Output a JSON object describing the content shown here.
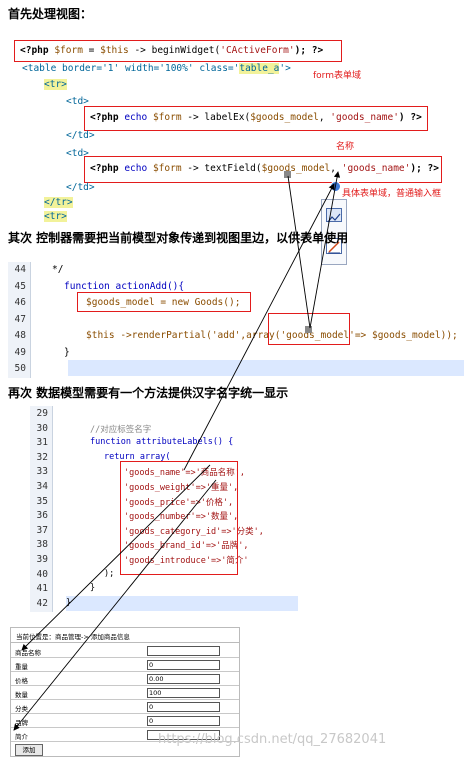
{
  "section1": {
    "heading": "首先处理视图：",
    "line1": {
      "a": "<?php ",
      "b": "$form",
      "c": " = ",
      "d": "$this",
      "e": " -> beginWidget(",
      "f": "'CActiveForm'",
      "g": "); ?>"
    },
    "line2": {
      "a": "<table ",
      "b": "border='1' width='100%' class='",
      "c": "table_a",
      "d": "'>"
    },
    "tr_open": "<tr>",
    "td_open1": "<td>",
    "line_label": {
      "a": "<?php ",
      "b": "echo ",
      "c": "$form",
      "d": " -> labelEx(",
      "e": "$goods_model",
      "f": ", ",
      "g": "'goods_name'",
      "h": ") ?>"
    },
    "td_close1": "</td>",
    "td_open2": "<td>",
    "line_text": {
      "a": "<?php ",
      "b": "echo ",
      "c": "$form",
      "d": " -> textField(",
      "e": "$goods_model",
      "f": ", ",
      "g": "'goods_name'",
      "h": "); ?>"
    },
    "td_close2": "</td>",
    "tr_close": "</tr>",
    "tr_open2": "<tr>",
    "annot_form": "form表单域",
    "annot_name": "名称",
    "annot_input": "具体表单域，普通输入框"
  },
  "section2": {
    "heading": "其次 控制器需要把当前模型对象传递到视图里边，以供表单使用",
    "lines": [
      {
        "no": "44",
        "text": "*/"
      },
      {
        "no": "45",
        "text": "function actionAdd(){"
      },
      {
        "no": "46",
        "text": "$goods_model = new Goods();"
      },
      {
        "no": "47",
        "text": ""
      },
      {
        "no": "48",
        "text": "$this ->renderPartial('add',array('goods_model'=> $goods_model));"
      },
      {
        "no": "49",
        "text": "}"
      },
      {
        "no": "50",
        "text": ""
      }
    ]
  },
  "section3": {
    "heading": "再次 数据模型需要有一个方法提供汉字名字统一显示",
    "lines": [
      {
        "no": "29",
        "text": ""
      },
      {
        "no": "30",
        "text": "//对应标签名字"
      },
      {
        "no": "31",
        "text": "function attributeLabels() {"
      },
      {
        "no": "32",
        "text": "return array("
      },
      {
        "no": "33",
        "text": "'goods_name'=>'商品名称',"
      },
      {
        "no": "34",
        "text": "'goods_weight'=>'重量',"
      },
      {
        "no": "35",
        "text": "'goods_price'=>'价格',"
      },
      {
        "no": "36",
        "text": "'goods_number'=>'数量',"
      },
      {
        "no": "37",
        "text": "'goods_category_id'=>'分类',"
      },
      {
        "no": "38",
        "text": "'goods_brand_id'=>'品牌',"
      },
      {
        "no": "39",
        "text": "'goods_introduce'=>'简介'"
      },
      {
        "no": "40",
        "text": ");"
      },
      {
        "no": "41",
        "text": "}"
      },
      {
        "no": "42",
        "text": "}"
      }
    ]
  },
  "form_preview": {
    "breadcrumb": "当前位置是：商品管理-> 添加商品信息",
    "rows": [
      {
        "label": "商品名称",
        "value": ""
      },
      {
        "label": "重量",
        "value": "0"
      },
      {
        "label": "价格",
        "value": "0.00"
      },
      {
        "label": "数量",
        "value": "100"
      },
      {
        "label": "分类",
        "value": "0"
      },
      {
        "label": "品牌",
        "value": "0"
      },
      {
        "label": "简介",
        "value": ""
      }
    ],
    "submit_label": "添加"
  },
  "watermark": "https://blog.csdn.net/qq_27682041",
  "colors": {
    "annotation_red": "#e21c1c",
    "highlight_yellow": "#f2f29a",
    "keyword_blue": "#0000c0"
  }
}
